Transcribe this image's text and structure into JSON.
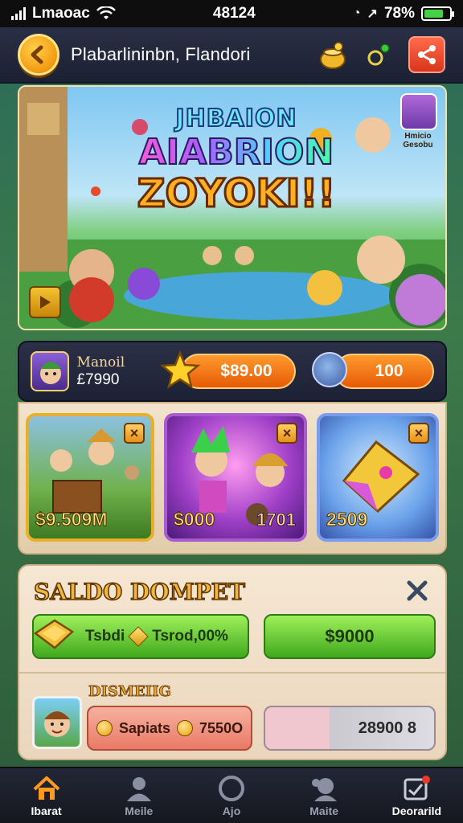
{
  "status_bar": {
    "carrier": "Lmaoac",
    "time": "48124",
    "battery_percent": "78%",
    "battery_level": 0.78
  },
  "header": {
    "title": "Plabarlininbn, Flandori",
    "back_icon": "arrow-left-icon",
    "share_icon": "share-icon"
  },
  "banner": {
    "line1": "JHBAION",
    "line2": "AIABRION",
    "line3": "ZOYOKI!!",
    "avatar_label": "Hmicio Gesobu"
  },
  "resources": {
    "player_name": "Manoil",
    "player_score": "£7990",
    "coins": "$89.00",
    "gems": "100"
  },
  "shop_cards": [
    {
      "price": "$9.509M",
      "extra": ""
    },
    {
      "price": "$000",
      "extra": "1701"
    },
    {
      "price": "2509",
      "extra": ""
    }
  ],
  "wallet": {
    "title": "SALDO DOMPET",
    "topup_label": "Tsbdi",
    "topup_value": "Tsrod,00%",
    "balance_value": "$9000",
    "section_label": "DISMEIIG",
    "swap_label": "Sapiats",
    "swap_value": "7550O",
    "total_value": "28900 8"
  },
  "nav": {
    "items": [
      {
        "label": "Ibarat",
        "icon": "home-icon"
      },
      {
        "label": "Meile",
        "icon": "profile-icon"
      },
      {
        "label": "Ajo",
        "icon": "circle-icon"
      },
      {
        "label": "Maite",
        "icon": "friends-icon"
      },
      {
        "label": "Deorarild",
        "icon": "inbox-icon"
      }
    ]
  },
  "colors": {
    "accent_orange": "#f29a10",
    "green_button": "#3fa81c",
    "header_bg": "#1c2033"
  }
}
